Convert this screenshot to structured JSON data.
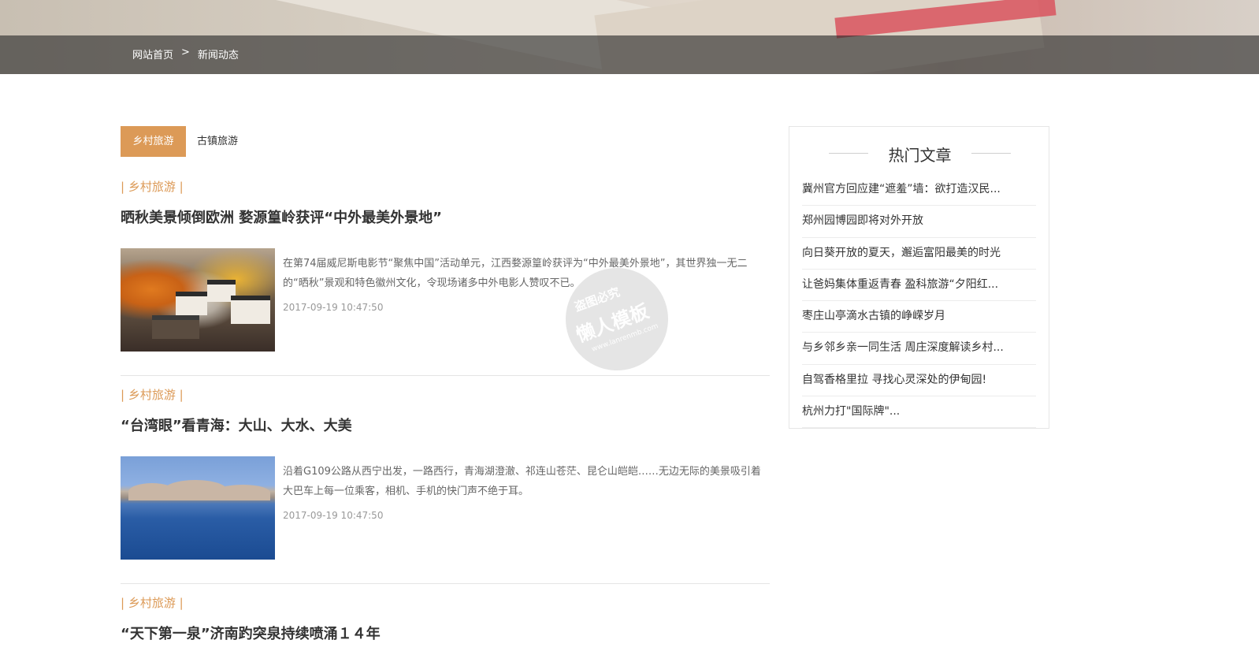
{
  "breadcrumb": {
    "home": "网站首页",
    "separator": ">",
    "current": "新闻动态"
  },
  "tabs": [
    {
      "label": "乡村旅游",
      "active": true
    },
    {
      "label": "古镇旅游",
      "active": false
    }
  ],
  "articles": [
    {
      "category": "| 乡村旅游 |",
      "title": "晒秋美景倾倒欧洲 婺源篁岭获评“中外最美外景地”",
      "description": "在第74届威尼斯电影节“聚焦中国”活动单元，江西婺源篁岭获评为“中外最美外景地”，其世界独一无二的“晒秋”景观和特色徽州文化，令现场诸多中外电影人赞叹不已。",
      "date": "2017-09-19 10:47:50"
    },
    {
      "category": "| 乡村旅游 |",
      "title": "“台湾眼”看青海：大山、大水、大美",
      "description": "沿着G109公路从西宁出发，一路西行，青海湖澄澈、祁连山苍茫、昆仑山皑皑……无边无际的美景吸引着大巴车上每一位乘客，相机、手机的快门声不绝于耳。",
      "date": "2017-09-19 10:47:50"
    },
    {
      "category": "| 乡村旅游 |",
      "title": "“天下第一泉”济南趵突泉持续喷涌１４年"
    }
  ],
  "sidebar": {
    "title": "热门文章",
    "items": [
      "冀州官方回应建“遮羞”墙：欲打造汉民...",
      "郑州园博园即将对外开放",
      "向日葵开放的夏天，邂逅富阳最美的时光",
      "让爸妈集体重返青春 盈科旅游“夕阳红...",
      "枣庄山亭滴水古镇的峥嵘岁月",
      "与乡邻乡亲一同生活 周庄深度解读乡村...",
      "自驾香格里拉 寻找心灵深处的伊甸园!",
      "杭州力打\"国际牌\"..."
    ]
  },
  "watermark": {
    "line1": "盗图必究",
    "line2": "懒人模板",
    "line3": "www.lanrenmb.com"
  },
  "colors": {
    "accent": "#dc9a57",
    "breadcrumb_bar": "#3f3f3f"
  }
}
